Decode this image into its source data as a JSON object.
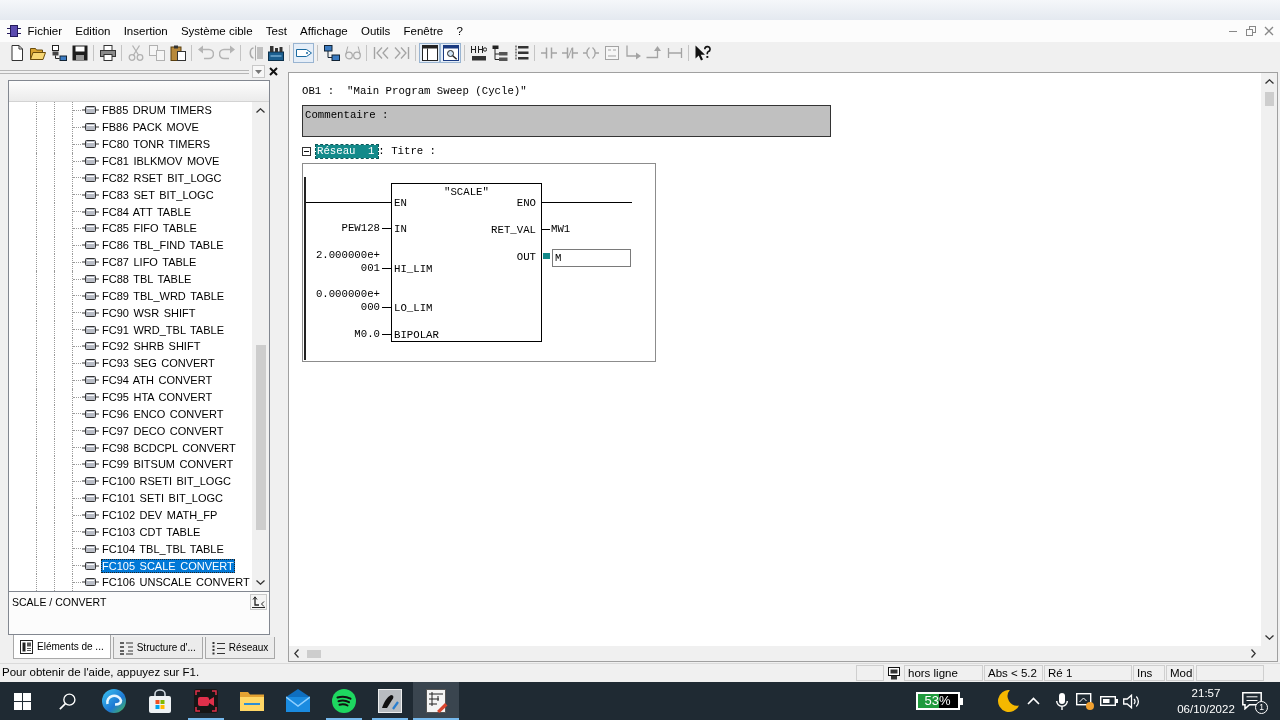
{
  "menu": [
    "Fichier",
    "Edition",
    "Insertion",
    "Système cible",
    "Test",
    "Affichage",
    "Outils",
    "Fenêtre",
    "?"
  ],
  "toolbar": {
    "groups": [
      [
        {
          "disabled": false,
          "pressed": false
        },
        {
          "disabled": false,
          "pressed": false
        },
        {
          "disabled": false,
          "pressed": false
        },
        {
          "disabled": false,
          "pressed": false
        }
      ],
      [
        {
          "disabled": false,
          "pressed": false
        }
      ],
      [
        {
          "disabled": true,
          "pressed": false
        },
        {
          "disabled": true,
          "pressed": false
        },
        {
          "disabled": false,
          "pressed": false
        }
      ],
      [
        {
          "disabled": true,
          "pressed": false
        },
        {
          "disabled": true,
          "pressed": false
        }
      ],
      [
        {
          "disabled": true,
          "pressed": false
        },
        {
          "disabled": false,
          "pressed": false
        }
      ],
      [
        {
          "disabled": false,
          "pressed": true
        }
      ],
      [
        {
          "disabled": false,
          "pressed": false
        },
        {
          "disabled": true,
          "pressed": false
        }
      ],
      [
        {
          "disabled": true,
          "pressed": false
        },
        {
          "disabled": true,
          "pressed": false
        }
      ],
      [
        {
          "disabled": false,
          "pressed": true
        },
        {
          "disabled": false,
          "pressed": true
        }
      ],
      [
        {
          "disabled": false,
          "pressed": false
        },
        {
          "disabled": false,
          "pressed": false
        },
        {
          "disabled": false,
          "pressed": false
        }
      ],
      [
        {
          "disabled": true,
          "pressed": false
        },
        {
          "disabled": true,
          "pressed": false
        },
        {
          "disabled": true,
          "pressed": false
        },
        {
          "disabled": true,
          "pressed": false
        },
        {
          "disabled": true,
          "pressed": false
        },
        {
          "disabled": true,
          "pressed": false
        },
        {
          "disabled": true,
          "pressed": false
        }
      ],
      [
        {
          "disabled": false,
          "pressed": false
        }
      ]
    ]
  },
  "catalog": {
    "items": [
      {
        "label": "FB85 DRUM TIMERS",
        "selected": false
      },
      {
        "label": "FB86 PACK MOVE",
        "selected": false
      },
      {
        "label": "FC80 TONR TIMERS",
        "selected": false
      },
      {
        "label": "FC81 IBLKMOV MOVE",
        "selected": false
      },
      {
        "label": "FC82 RSET BIT_LOGC",
        "selected": false
      },
      {
        "label": "FC83 SET BIT_LOGC",
        "selected": false
      },
      {
        "label": "FC84 ATT TABLE",
        "selected": false
      },
      {
        "label": "FC85 FIFO TABLE",
        "selected": false
      },
      {
        "label": "FC86 TBL_FIND TABLE",
        "selected": false
      },
      {
        "label": "FC87 LIFO TABLE",
        "selected": false
      },
      {
        "label": "FC88 TBL TABLE",
        "selected": false
      },
      {
        "label": "FC89 TBL_WRD TABLE",
        "selected": false
      },
      {
        "label": "FC90 WSR SHIFT",
        "selected": false
      },
      {
        "label": "FC91 WRD_TBL TABLE",
        "selected": false
      },
      {
        "label": "FC92 SHRB SHIFT",
        "selected": false
      },
      {
        "label": "FC93 SEG CONVERT",
        "selected": false
      },
      {
        "label": "FC94 ATH CONVERT",
        "selected": false
      },
      {
        "label": "FC95 HTA CONVERT",
        "selected": false
      },
      {
        "label": "FC96 ENCO CONVERT",
        "selected": false
      },
      {
        "label": "FC97 DECO CONVERT",
        "selected": false
      },
      {
        "label": "FC98 BCDCPL CONVERT",
        "selected": false
      },
      {
        "label": "FC99 BITSUM CONVERT",
        "selected": false
      },
      {
        "label": "FC100 RSETI BIT_LOGC",
        "selected": false
      },
      {
        "label": "FC101 SETI BIT_LOGC",
        "selected": false
      },
      {
        "label": "FC102 DEV MATH_FP",
        "selected": false
      },
      {
        "label": "FC103 CDT TABLE",
        "selected": false
      },
      {
        "label": "FC104 TBL_TBL TABLE",
        "selected": false
      },
      {
        "label": "FC105 SCALE CONVERT",
        "selected": true
      },
      {
        "label": "FC106 UNSCALE CONVERT",
        "selected": false
      }
    ],
    "description": "SCALE / CONVERT",
    "tabs": [
      {
        "label": "Eléments de ...",
        "selected": true
      },
      {
        "label": "Structure d'...",
        "selected": false
      },
      {
        "label": "Réseaux",
        "selected": false
      }
    ]
  },
  "editor": {
    "block": "OB1 :",
    "title": "\"Main Program Sweep (Cycle)\"",
    "comment": "Commentaire :",
    "network": {
      "label": "Réseau 1",
      "selected": true,
      "expanded": true,
      "title": ": Titre :",
      "block": {
        "name": "\"SCALE\"",
        "inputs": [
          {
            "pin": "EN"
          },
          {
            "pin": "IN",
            "operand": "PEW128"
          },
          {
            "pin": "HI_LIM",
            "operand": "2.000000e+001"
          },
          {
            "pin": "LO_LIM",
            "operand": "0.000000e+000"
          },
          {
            "pin": "BIPOLAR",
            "operand": "M0.0"
          }
        ],
        "outputs": [
          {
            "pin": "ENO"
          },
          {
            "pin": "RET_VAL",
            "operand": "MW1"
          },
          {
            "pin": "OUT",
            "value": "M"
          }
        ]
      }
    }
  },
  "status_bar": {
    "message": "Pour obtenir de l'aide, appuyez sur F1.",
    "panes": [
      "hors ligne",
      "Abs < 5.2",
      "Ré 1",
      "Ins",
      "Mod"
    ]
  },
  "taskbar": {
    "apps": [
      {
        "running": false,
        "active": false
      },
      {
        "running": false,
        "active": false
      },
      {
        "running": true,
        "active": false
      },
      {
        "running": false,
        "active": false
      },
      {
        "running": false,
        "active": false
      },
      {
        "running": true,
        "active": false
      },
      {
        "running": true,
        "active": false
      },
      {
        "running": true,
        "active": true
      }
    ],
    "battery": {
      "level": 0.53,
      "reading": "53%"
    },
    "clock": {
      "time": "21:57",
      "date": "06/10/2022"
    },
    "notifications": "1"
  }
}
